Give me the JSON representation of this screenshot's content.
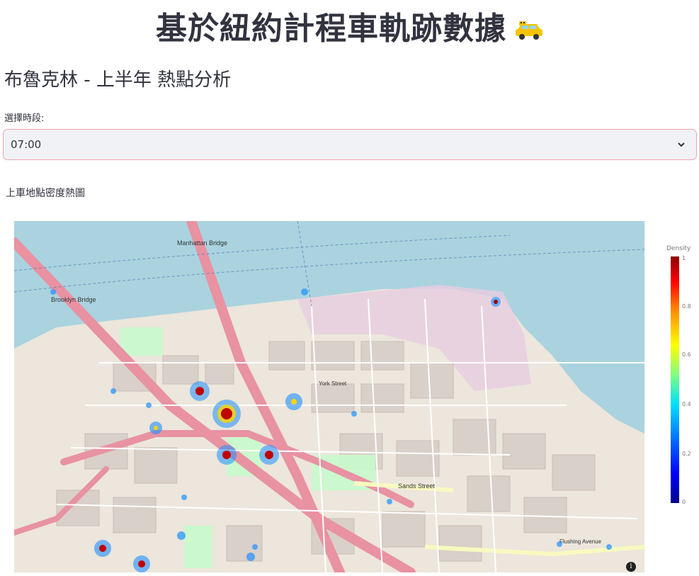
{
  "page": {
    "title": "基於紐約計程車軌跡數據",
    "title_emoji": "taxi-icon",
    "subtitle": "布魯克林 - 上半年 熱點分析"
  },
  "time_select": {
    "label": "選擇時段:",
    "value": "07:00",
    "accent": "#f2a2a8"
  },
  "map": {
    "caption": "上車地點密度熱圖",
    "colorbar_title": "Density",
    "colorbar_ticks": [
      "1",
      "0.8",
      "0.6",
      "0.4",
      "0.2",
      "0"
    ],
    "labels": {
      "manhattan_bridge": "Manhattan Bridge",
      "brooklyn_bridge": "Brooklyn Bridge",
      "sands_street": "Sands Street",
      "york_street": "York Street",
      "flushing_ave": "Flushing Avenue"
    }
  }
}
